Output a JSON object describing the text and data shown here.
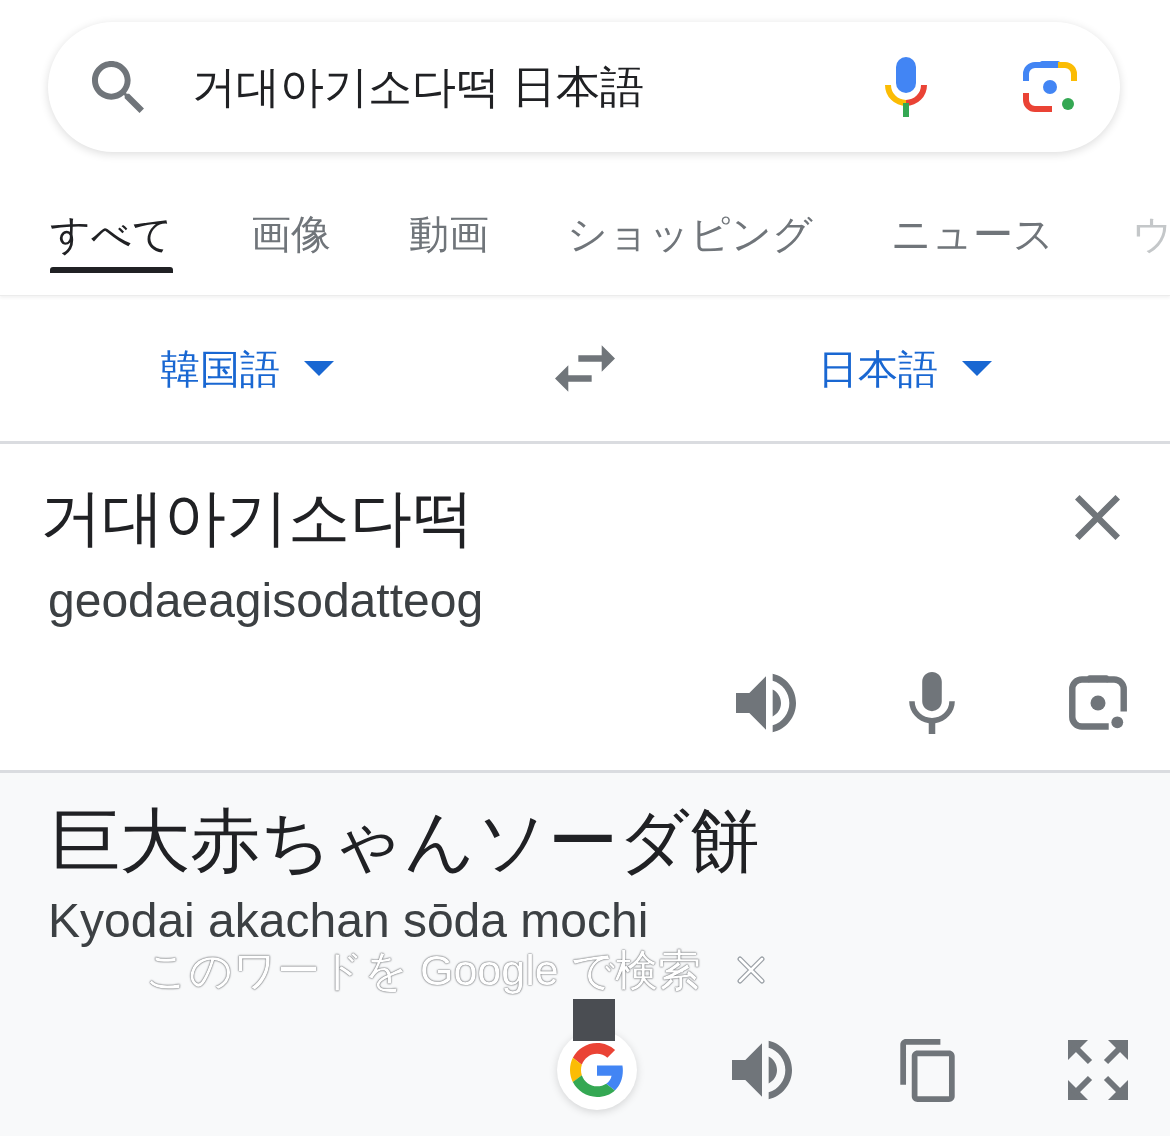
{
  "search": {
    "query": "거대아기소다떡 日本語"
  },
  "tabs": [
    {
      "label": "すべて",
      "selected": true
    },
    {
      "label": "画像",
      "selected": false
    },
    {
      "label": "動画",
      "selected": false
    },
    {
      "label": "ショッピング",
      "selected": false
    },
    {
      "label": "ニュース",
      "selected": false
    },
    {
      "label": "ウ",
      "selected": false
    }
  ],
  "translator": {
    "source_language": "韓国語",
    "target_language": "日本語",
    "source": {
      "text": "거대아기소다떡",
      "romanization": "geodaeagisodatteog"
    },
    "target": {
      "text": "巨大赤ちゃんソーダ餅",
      "romanization": "Kyodai akachan sōda mochi"
    }
  },
  "search_hint": {
    "label": "このワードを Google で検索"
  }
}
